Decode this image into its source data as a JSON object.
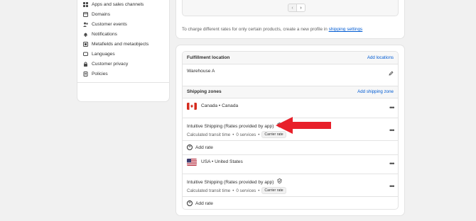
{
  "sidebar": {
    "items": [
      {
        "label": "Apps and sales channels",
        "icon": "apps-icon"
      },
      {
        "label": "Domains",
        "icon": "domain-icon"
      },
      {
        "label": "Customer events",
        "icon": "customer-events-icon"
      },
      {
        "label": "Notifications",
        "icon": "bell-icon"
      },
      {
        "label": "Metafields and metaobjects",
        "icon": "metafields-icon"
      },
      {
        "label": "Languages",
        "icon": "language-icon"
      },
      {
        "label": "Customer privacy",
        "icon": "lock-icon"
      },
      {
        "label": "Policies",
        "icon": "policy-icon"
      }
    ]
  },
  "top": {
    "pager_prev": "‹",
    "pager_next": "›",
    "hint_text": "To charge different rates for only certain products, create a new profile in",
    "hint_link": "shipping settings"
  },
  "fulfillment": {
    "title": "Fulfillment location",
    "action": "Add locations",
    "location": "Warehouse A"
  },
  "zones": {
    "title": "Shipping zones",
    "action": "Add shipping zone",
    "items": [
      {
        "name": "Canada • Canada",
        "flag": "canada-flag",
        "rate_name": "Intuitive Shipping (Rates provided by app)",
        "transit": "Calculated transit time",
        "services": "0 services",
        "badge": "Carrier rate",
        "add_rate": "Add rate"
      },
      {
        "name": "USA • United States",
        "flag": "usa-flag",
        "rate_name": "Intuitive Shipping (Rates provided by app)",
        "transit": "Calculated transit time",
        "services": "0 services",
        "badge": "Carrier rate",
        "add_rate": "Add rate"
      }
    ]
  },
  "separator": "•",
  "colors": {
    "link": "#005bd3",
    "arrow": "#e8202a",
    "background": "#f1f1f1"
  }
}
